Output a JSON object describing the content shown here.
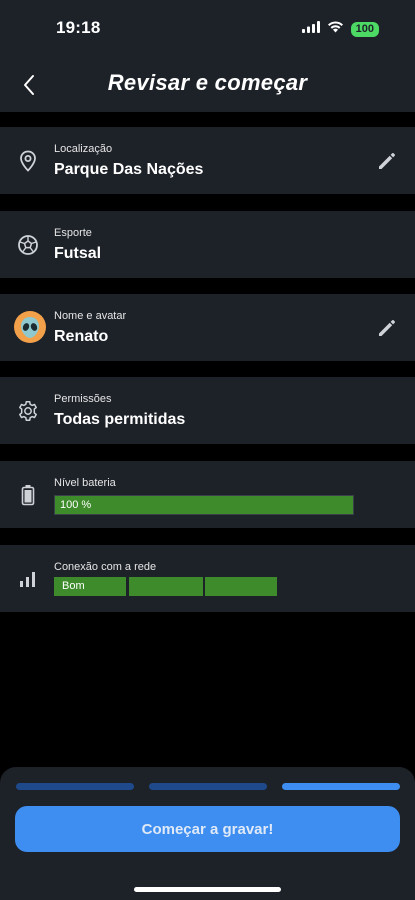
{
  "status_bar": {
    "time": "19:18",
    "battery": "100"
  },
  "header": {
    "title": "Revisar e começar"
  },
  "rows": [
    {
      "label": "Localização",
      "value": "Parque Das Nações"
    },
    {
      "label": "Esporte",
      "value": "Futsal"
    },
    {
      "label": "Nome e avatar",
      "value": "Renato"
    },
    {
      "label": "Permissões",
      "value": "Todas permitidas"
    }
  ],
  "battery_level": {
    "label": "Nível bateria",
    "value_text": "100 %",
    "percent": 100
  },
  "network": {
    "label": "Conexão com a rede",
    "value_text": "Bom",
    "bars_filled": 3,
    "bars_total": 3
  },
  "steps": {
    "total": 3,
    "current": 3
  },
  "footer": {
    "start_button": "Começar a gravar!"
  },
  "colors": {
    "background": "#000000",
    "card": "#1d2128",
    "accent": "#3d8ef0",
    "progress": "#3d8b2a",
    "step_inactive": "#1e4a8c",
    "step_active": "#3d8ef0"
  }
}
